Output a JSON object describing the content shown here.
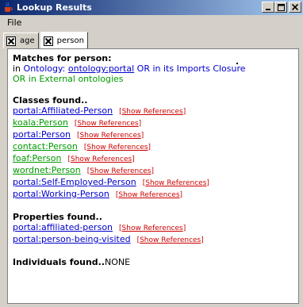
{
  "window": {
    "title": "Lookup Results"
  },
  "menu": {
    "file": "File"
  },
  "tabs": [
    {
      "label": "age",
      "selected": false
    },
    {
      "label": "person",
      "selected": true
    }
  ],
  "matches": {
    "heading": "Matches for person:",
    "line1_prefix": "in ",
    "line1_ontology": "Ontology: ",
    "line1_link": "ontology:portal",
    "line1_suffix": " OR in its Imports Closure",
    "line2": "OR in External ontologies"
  },
  "classes": {
    "heading": "Classes found..",
    "items": [
      {
        "name": "portal:Affiliated-Person",
        "color": "#0000cc",
        "refs": "Show References"
      },
      {
        "name": "koala:Person",
        "color": "#009900",
        "refs": "Show References"
      },
      {
        "name": "portal:Person",
        "color": "#0000cc",
        "refs": "Show References"
      },
      {
        "name": "contact:Person",
        "color": "#009900",
        "refs": "Show References"
      },
      {
        "name": "foaf:Person",
        "color": "#009900",
        "refs": "Show References"
      },
      {
        "name": "wordnet:Person",
        "color": "#009900",
        "refs": "Show References"
      },
      {
        "name": "portal:Self-Employed-Person",
        "color": "#0000cc",
        "refs": "Show References"
      },
      {
        "name": "portal:Working-Person",
        "color": "#0000cc",
        "refs": "Show References"
      }
    ]
  },
  "properties": {
    "heading": "Properties found..",
    "items": [
      {
        "name": "portal:affiliated-person",
        "color": "#0000cc",
        "refs": "Show References"
      },
      {
        "name": "portal:person-being-visited",
        "color": "#0000cc",
        "refs": "Show References"
      }
    ]
  },
  "individuals": {
    "heading": "Individuals found..",
    "value": "NONE"
  },
  "colors": {
    "titlebar_start": "#0a246a",
    "titlebar_end": "#a6caf0",
    "ontology_link": "#0000cc",
    "external_link": "#009900",
    "references": "#cc0000"
  }
}
